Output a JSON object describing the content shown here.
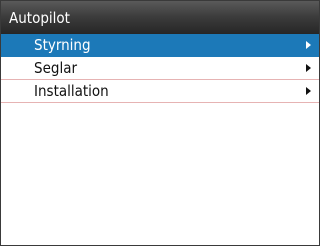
{
  "header": {
    "title": "Autopilot"
  },
  "menu": {
    "items": [
      {
        "label": "Styrning",
        "selected": true,
        "icon": "chevron-right-icon"
      },
      {
        "label": "Seglar",
        "selected": false,
        "icon": "chevron-right-icon"
      },
      {
        "label": "Installation",
        "selected": false,
        "icon": "chevron-right-icon"
      }
    ]
  },
  "colors": {
    "title_bar": "#2e2e2e",
    "selection": "#1c79b8",
    "row_divider": "#e6b3b3"
  }
}
